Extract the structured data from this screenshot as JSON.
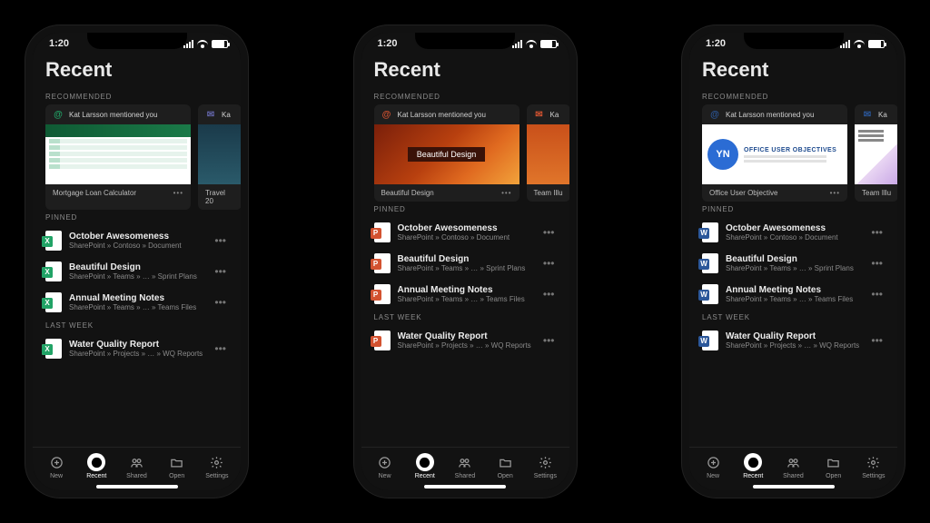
{
  "status": {
    "time": "1:20"
  },
  "title": "Recent",
  "sections": {
    "recommended": "RECOMMENDED",
    "pinned": "PINNED",
    "last_week": "LAST WEEK"
  },
  "mention_text": "Kat Larsson mentioned you",
  "mention_partial": "Ka",
  "phones": [
    {
      "app": "excel",
      "reco_main_title": "Mortgage Loan Calculator",
      "reco_partial_title": "Travel 20",
      "thumb_label": ""
    },
    {
      "app": "pp",
      "reco_main_title": "Beautiful Design",
      "reco_partial_title": "Team Illu",
      "thumb_label": "Beautiful Design"
    },
    {
      "app": "word",
      "reco_main_title": "Office User Objective",
      "reco_partial_title": "Team Illu",
      "thumb_label": "OFFICE USER OBJECTIVES",
      "thumb_badge": "YN"
    }
  ],
  "pinned_items": [
    {
      "name": "October Awesomeness",
      "path": "SharePoint » Contoso » Document"
    },
    {
      "name": "Beautiful Design",
      "path": "SharePoint » Teams » … » Sprint Plans"
    },
    {
      "name": "Annual Meeting Notes",
      "path": "SharePoint » Teams » … » Teams Files"
    }
  ],
  "lastweek_items": [
    {
      "name": "Water Quality Report",
      "path": "SharePoint » Projects » … » WQ Reports"
    }
  ],
  "nav": {
    "new": "New",
    "recent": "Recent",
    "shared": "Shared",
    "open": "Open",
    "settings": "Settings"
  },
  "glyphs": {
    "excel": "X",
    "pp": "P",
    "word": "W"
  }
}
